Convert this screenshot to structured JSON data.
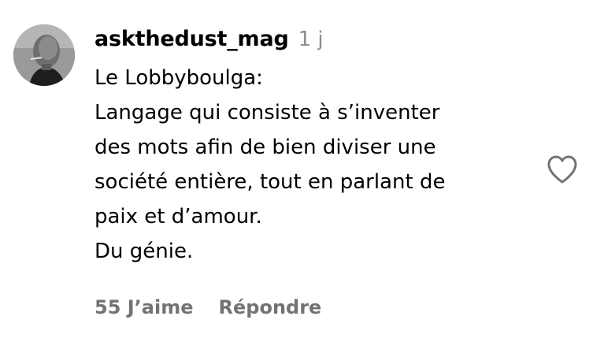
{
  "comment": {
    "username": "askthedust_mag",
    "timestamp": "1 j",
    "lines": [
      "Le Lobbyboulga:",
      "Langage qui consiste à s’inventer",
      "des mots afin de bien diviser une",
      "société entière, tout en parlant de",
      "paix et d’amour.",
      "Du génie."
    ],
    "likes_label": "55 J’aime",
    "reply_label": "Répondre",
    "like_icon": "heart-outline-icon"
  },
  "colors": {
    "text": "#000000",
    "muted": "#737373",
    "timestamp": "#8e8e8e",
    "background": "#ffffff"
  }
}
